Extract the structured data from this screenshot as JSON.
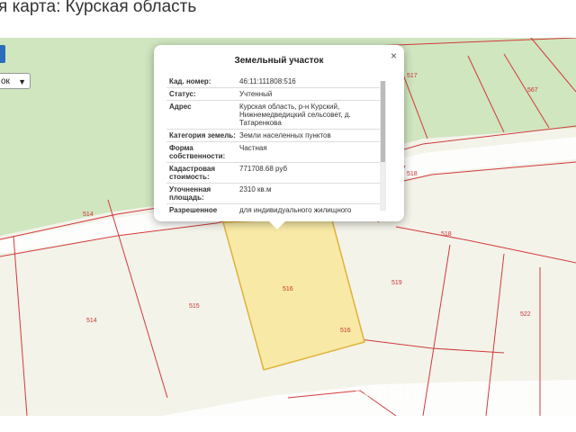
{
  "page": {
    "title": "я карта: Курская область"
  },
  "controls": {
    "select_value": "ок"
  },
  "popup": {
    "title": "Земельный участок",
    "close": "×",
    "rows": [
      {
        "key": "Кад. номер:",
        "value": "46:11:111808:516"
      },
      {
        "key": "Статус:",
        "value": "Учтенный"
      },
      {
        "key": "Адрес",
        "value": "Курская область, р-н Курский, Нижнемедведицкий сельсовет, д. Татаренкова"
      },
      {
        "key": "Категория земель:",
        "value": "Земли населенных пунктов"
      },
      {
        "key": "Форма собственности:",
        "value": "Частная"
      },
      {
        "key": "Кадастровая стоимость:",
        "value": "771708.68 руб"
      },
      {
        "key": "Уточненная площадь:",
        "value": "2310 кв.м"
      },
      {
        "key": "Разрешенное",
        "value": "для индивидуального жилищного"
      }
    ]
  },
  "map": {
    "colors": {
      "background": "#f3f3ea",
      "green": "#cfe6bf",
      "parcel_line": "#d33a3a",
      "selected_fill": "#f8e9a6",
      "selected_stroke": "#e0b23a",
      "road": "#ffffff"
    },
    "plot_labels": [
      "517",
      "567",
      "514",
      "518",
      "518",
      "514",
      "515",
      "516",
      "516",
      "519",
      "522"
    ]
  },
  "watermark": "циан"
}
